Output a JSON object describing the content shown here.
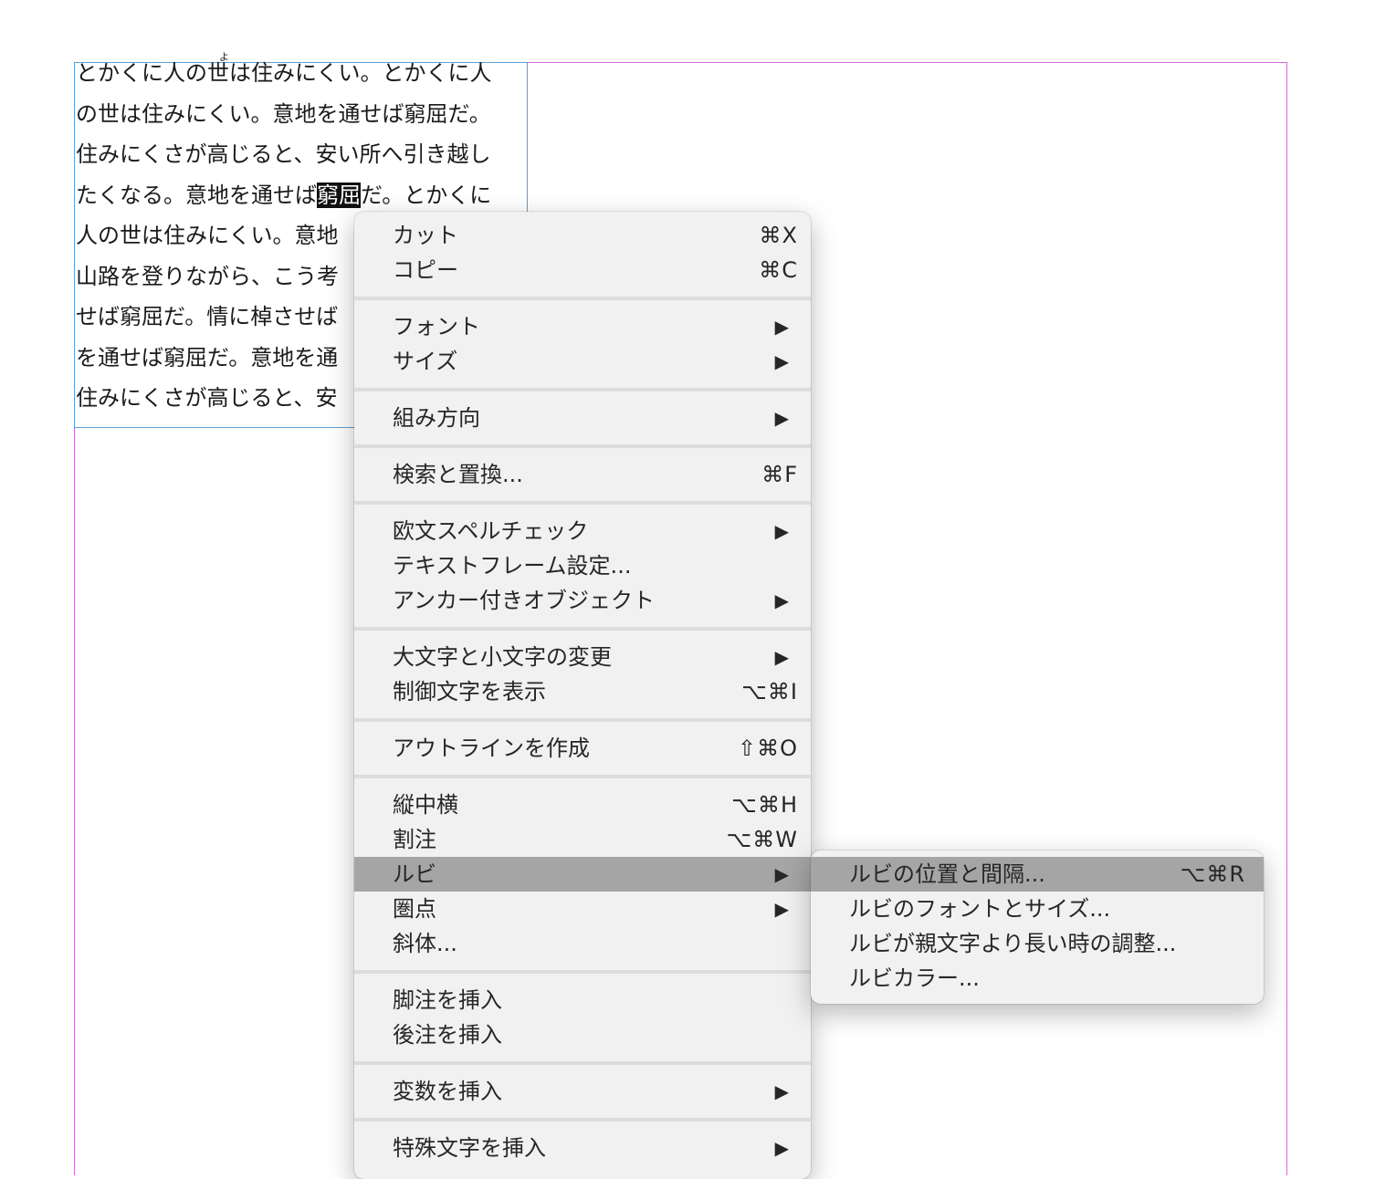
{
  "document": {
    "ruby_annotation": "よ",
    "lines": [
      {
        "before": "とかくに人の世は住みにくい。とかくに人",
        "selected": "",
        "after": ""
      },
      {
        "before": "の世は住みにくい。意地を通せば窮屈だ。",
        "selected": "",
        "after": ""
      },
      {
        "before": "住みにくさが高じると、安い所へ引き越し",
        "selected": "",
        "after": ""
      },
      {
        "before": "たくなる。意地を通せば",
        "selected": "窮屈",
        "after": "だ。とかくに"
      },
      {
        "before": "人の世は住みにくい。意地",
        "selected": "",
        "after": ""
      },
      {
        "before": "山路を登りながら、こう考",
        "selected": "",
        "after": ""
      },
      {
        "before": "せば窮屈だ。情に棹させば",
        "selected": "",
        "after": ""
      },
      {
        "before": "を通せば窮屈だ。意地を通",
        "selected": "",
        "after": ""
      },
      {
        "before": "住みにくさが高じると、安",
        "selected": "",
        "after": ""
      }
    ]
  },
  "context_menu": {
    "groups": [
      [
        {
          "label": "カット",
          "shortcut": "⌘X",
          "submenu": false
        },
        {
          "label": "コピー",
          "shortcut": "⌘C",
          "submenu": false
        }
      ],
      [
        {
          "label": "フォント",
          "shortcut": "",
          "submenu": true
        },
        {
          "label": "サイズ",
          "shortcut": "",
          "submenu": true
        }
      ],
      [
        {
          "label": "組み方向",
          "shortcut": "",
          "submenu": true
        }
      ],
      [
        {
          "label": "検索と置換...",
          "shortcut": "⌘F",
          "submenu": false
        }
      ],
      [
        {
          "label": "欧文スペルチェック",
          "shortcut": "",
          "submenu": true
        },
        {
          "label": "テキストフレーム設定...",
          "shortcut": "",
          "submenu": false
        },
        {
          "label": "アンカー付きオブジェクト",
          "shortcut": "",
          "submenu": true
        }
      ],
      [
        {
          "label": "大文字と小文字の変更",
          "shortcut": "",
          "submenu": true
        },
        {
          "label": "制御文字を表示",
          "shortcut": "⌥⌘I",
          "submenu": false
        }
      ],
      [
        {
          "label": "アウトラインを作成",
          "shortcut": "⇧⌘O",
          "submenu": false
        }
      ],
      [
        {
          "label": "縦中横",
          "shortcut": "⌥⌘H",
          "submenu": false
        },
        {
          "label": "割注",
          "shortcut": "⌥⌘W",
          "submenu": false
        },
        {
          "label": "ルビ",
          "shortcut": "",
          "submenu": true,
          "active": true
        },
        {
          "label": "圏点",
          "shortcut": "",
          "submenu": true
        },
        {
          "label": "斜体...",
          "shortcut": "",
          "submenu": false
        }
      ],
      [
        {
          "label": "脚注を挿入",
          "shortcut": "",
          "submenu": false
        },
        {
          "label": "後注を挿入",
          "shortcut": "",
          "submenu": false
        }
      ],
      [
        {
          "label": "変数を挿入",
          "shortcut": "",
          "submenu": true
        }
      ],
      [
        {
          "label": "特殊文字を挿入",
          "shortcut": "",
          "submenu": true
        }
      ]
    ],
    "submenu_arrow": "▶"
  },
  "ruby_submenu": {
    "items": [
      {
        "label": "ルビの位置と間隔...",
        "shortcut": "⌥⌘R",
        "active": true
      },
      {
        "label": "ルビのフォントとサイズ...",
        "shortcut": ""
      },
      {
        "label": "ルビが親文字より長い時の調整...",
        "shortcut": ""
      },
      {
        "label": "ルビカラー...",
        "shortcut": ""
      }
    ]
  },
  "colors": {
    "margin_guide": "#d46ad8",
    "frame_border": "#5aa0d8",
    "menu_bg": "#f1f1f1",
    "menu_highlight": "#a5a5a5",
    "selection": "#111111"
  }
}
